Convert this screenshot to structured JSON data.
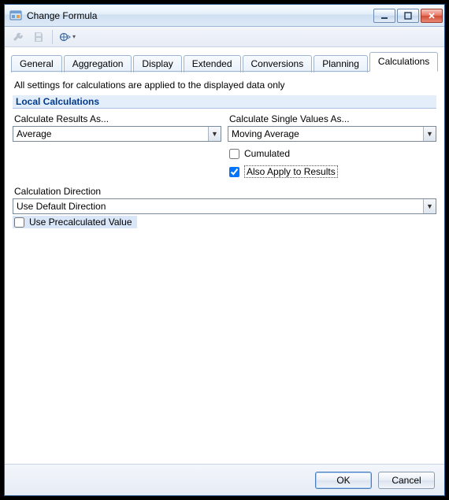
{
  "window": {
    "title": "Change Formula"
  },
  "toolbar": {
    "icons": [
      "wrench-icon",
      "save-icon",
      "tech-name-icon"
    ]
  },
  "tabs": [
    {
      "label": "General",
      "active": false
    },
    {
      "label": "Aggregation",
      "active": false
    },
    {
      "label": "Display",
      "active": false
    },
    {
      "label": "Extended",
      "active": false
    },
    {
      "label": "Conversions",
      "active": false
    },
    {
      "label": "Planning",
      "active": false
    },
    {
      "label": "Calculations",
      "active": true
    }
  ],
  "hint": "All settings for calculations are applied to the displayed data only",
  "group": {
    "title": "Local Calculations",
    "results_label": "Calculate Results As...",
    "results_value": "Average",
    "single_label": "Calculate Single Values As...",
    "single_value": "Moving Average",
    "cumulated_label": "Cumulated",
    "cumulated_checked": false,
    "apply_label": "Also Apply to Results",
    "apply_checked": true,
    "direction_label": "Calculation Direction",
    "direction_value": "Use Default Direction",
    "precalc_label": "Use Precalculated Value",
    "precalc_checked": false
  },
  "footer": {
    "ok": "OK",
    "cancel": "Cancel"
  }
}
